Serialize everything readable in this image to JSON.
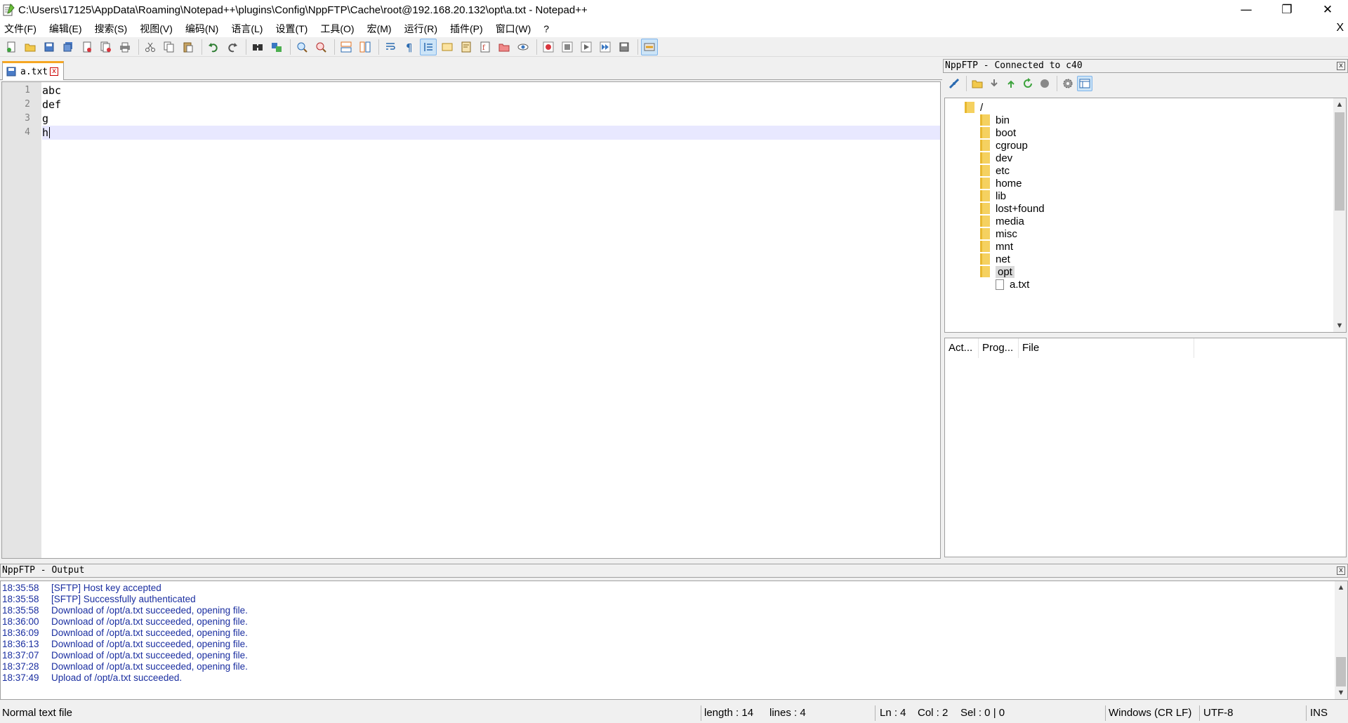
{
  "window": {
    "title": "C:\\Users\\17125\\AppData\\Roaming\\Notepad++\\plugins\\Config\\NppFTP\\Cache\\root@192.168.20.132\\opt\\a.txt - Notepad++",
    "minimize": "—",
    "restore": "❐",
    "close": "✕"
  },
  "menu": {
    "items": [
      "文件(F)",
      "编辑(E)",
      "搜索(S)",
      "视图(V)",
      "编码(N)",
      "语言(L)",
      "设置(T)",
      "工具(O)",
      "宏(M)",
      "运行(R)",
      "插件(P)",
      "窗口(W)",
      "?"
    ],
    "close": "X"
  },
  "tab": {
    "label": "a.txt",
    "close": "x"
  },
  "editor": {
    "lines": [
      {
        "num": "1",
        "text": "abc"
      },
      {
        "num": "2",
        "text": "def"
      },
      {
        "num": "3",
        "text": "g"
      },
      {
        "num": "4",
        "text": "h"
      }
    ],
    "current_line": 4
  },
  "ftp": {
    "title": "NppFTP - Connected to c40",
    "close": "x",
    "tree": {
      "root": "/",
      "folders": [
        "bin",
        "boot",
        "cgroup",
        "dev",
        "etc",
        "home",
        "lib",
        "lost+found",
        "media",
        "misc",
        "mnt",
        "net",
        "opt"
      ],
      "selected": "opt",
      "files": [
        "a.txt"
      ]
    },
    "queue_columns": [
      "Act...",
      "Prog...",
      "File"
    ]
  },
  "output": {
    "title": "NppFTP - Output",
    "close": "x",
    "lines": [
      {
        "time": "18:35:58",
        "msg": "[SFTP] Host key accepted"
      },
      {
        "time": "18:35:58",
        "msg": "[SFTP] Successfully authenticated"
      },
      {
        "time": "18:35:58",
        "msg": "Download of /opt/a.txt succeeded, opening file."
      },
      {
        "time": "18:36:00",
        "msg": "Download of /opt/a.txt succeeded, opening file."
      },
      {
        "time": "18:36:09",
        "msg": "Download of /opt/a.txt succeeded, opening file."
      },
      {
        "time": "18:36:13",
        "msg": "Download of /opt/a.txt succeeded, opening file."
      },
      {
        "time": "18:37:07",
        "msg": "Download of /opt/a.txt succeeded, opening file."
      },
      {
        "time": "18:37:28",
        "msg": "Download of /opt/a.txt succeeded, opening file."
      },
      {
        "time": "18:37:49",
        "msg": "Upload of /opt/a.txt succeeded."
      }
    ]
  },
  "status": {
    "file_type": "Normal text file",
    "length": "length : 14",
    "lines": "lines : 4",
    "ln": "Ln : 4",
    "col": "Col : 2",
    "sel": "Sel : 0 | 0",
    "eol": "Windows (CR LF)",
    "encoding": "UTF-8",
    "mode": "INS"
  },
  "colors": {
    "tab_accent": "#f5a623",
    "current_line": "#e8e8ff",
    "output_text": "#1a2ea0",
    "folder": "#f5d160"
  }
}
